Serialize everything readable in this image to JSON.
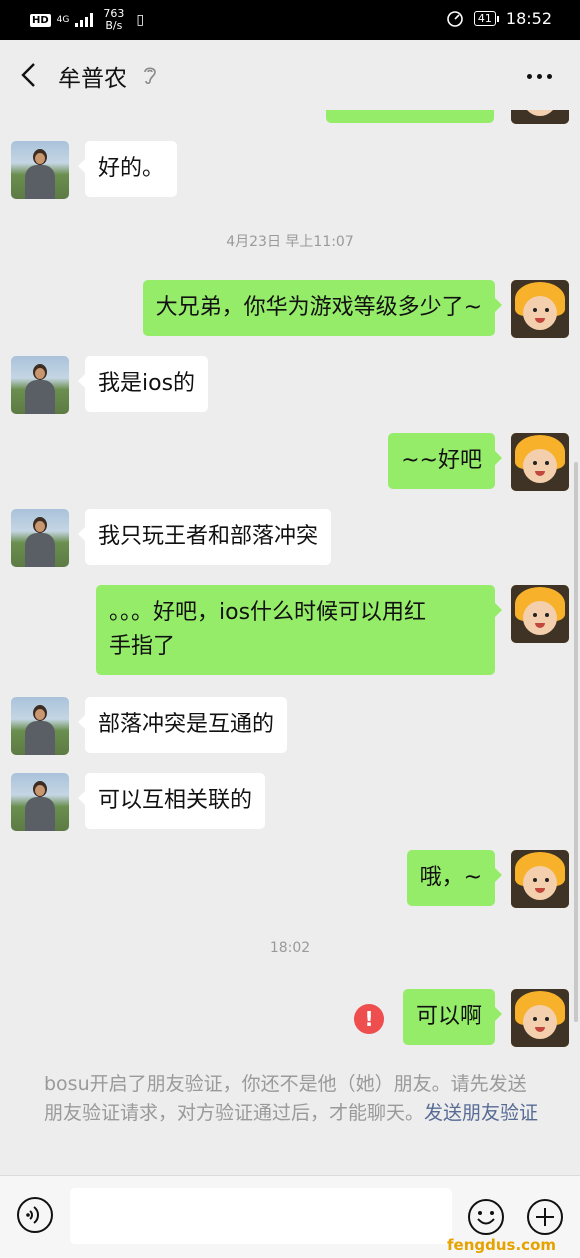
{
  "status_bar": {
    "hd": "HD",
    "network": "4G",
    "speed_value": "763",
    "speed_unit": "B/s",
    "battery": "41",
    "time": "18:52"
  },
  "header": {
    "title": "牟普农"
  },
  "messages": [
    {
      "side": "left",
      "text": "好的。"
    },
    {
      "timestamp": "4月23日 早上11:07"
    },
    {
      "side": "right",
      "text": "大兄弟，你华为游戏等级多少了~"
    },
    {
      "side": "left",
      "text": "我是ios的"
    },
    {
      "side": "right",
      "text": "~~好吧"
    },
    {
      "side": "left",
      "text": "我只玩王者和部落冲突"
    },
    {
      "side": "right",
      "text_line1": "。。。好吧，ios什么时候可以用红",
      "text_line2": "手指了"
    },
    {
      "side": "left",
      "text": "部落冲突是互通的"
    },
    {
      "side": "left",
      "text": "可以互相关联的"
    },
    {
      "side": "right",
      "text": "哦，~"
    },
    {
      "timestamp": "18:02"
    },
    {
      "side": "right",
      "text": "可以啊",
      "failed_mark": "!"
    }
  ],
  "system_note": {
    "text": "bosu开启了朋友验证，你还不是他（她）朋友。请先发送朋友验证请求，对方验证通过后，才能聊天。",
    "link": "发送朋友验证"
  },
  "watermark": "fengdus.com",
  "colors": {
    "sent_bubble": "#95ec69",
    "received_bubble": "#ffffff",
    "background": "#ededed",
    "link": "#576b95",
    "error": "#ee4e4e"
  },
  "icons": {
    "back": "chevron-left-icon",
    "ear": "earpiece-icon",
    "more": "more-dots-icon",
    "voice": "voice-icon",
    "emoji": "emoji-icon",
    "plus": "plus-icon"
  }
}
